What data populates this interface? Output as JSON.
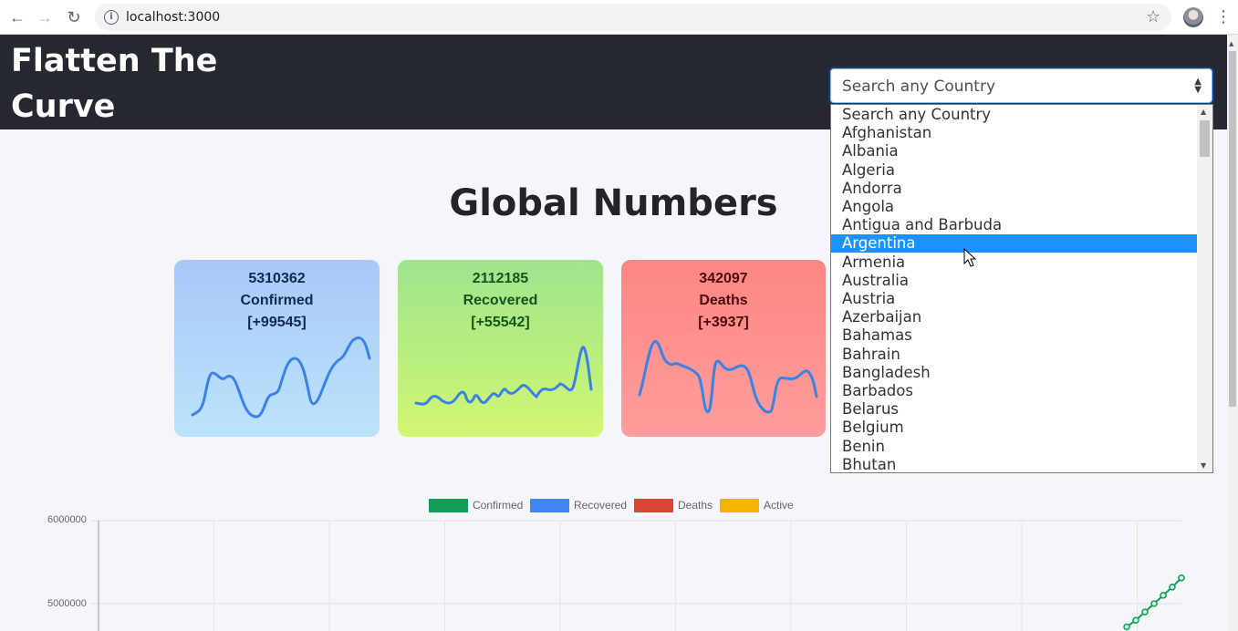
{
  "browser": {
    "back_icon": "arrow-left",
    "forward_icon": "arrow-right",
    "reload_icon": "reload",
    "url": "localhost:3000",
    "info_glyph": "i"
  },
  "app": {
    "title": "Flatten The Curve"
  },
  "country_select": {
    "selected": "Search any Country",
    "options": [
      "Search any Country",
      "Afghanistan",
      "Albania",
      "Algeria",
      "Andorra",
      "Angola",
      "Antigua and Barbuda",
      "Argentina",
      "Armenia",
      "Australia",
      "Austria",
      "Azerbaijan",
      "Bahamas",
      "Bahrain",
      "Bangladesh",
      "Barbados",
      "Belarus",
      "Belgium",
      "Benin",
      "Bhutan"
    ],
    "highlighted": "Argentina"
  },
  "global": {
    "heading": "Global Numbers",
    "cards": [
      {
        "number": "5310362",
        "label": "Confirmed",
        "delta": "[+99545]"
      },
      {
        "number": "2112185",
        "label": "Recovered",
        "delta": "[+55542]"
      },
      {
        "number": "342097",
        "label": "Deaths",
        "delta": "[+3937]"
      }
    ]
  },
  "colors": {
    "sparkline": "#3b82e6",
    "confirmed": "#0f9d58",
    "recovered": "#4285f4",
    "deaths": "#db4437",
    "active": "#f4b400"
  },
  "chart_data": {
    "type": "line",
    "legend": [
      "Confirmed",
      "Recovered",
      "Deaths",
      "Active"
    ],
    "legend_position": "top",
    "ytick_labels": [
      "6000000",
      "5000000"
    ],
    "grid": true,
    "series": [
      {
        "name": "Confirmed",
        "values_tail": [
          4720000,
          4800000,
          4900000,
          5000000,
          5100000,
          5200000,
          5310362
        ]
      }
    ]
  }
}
